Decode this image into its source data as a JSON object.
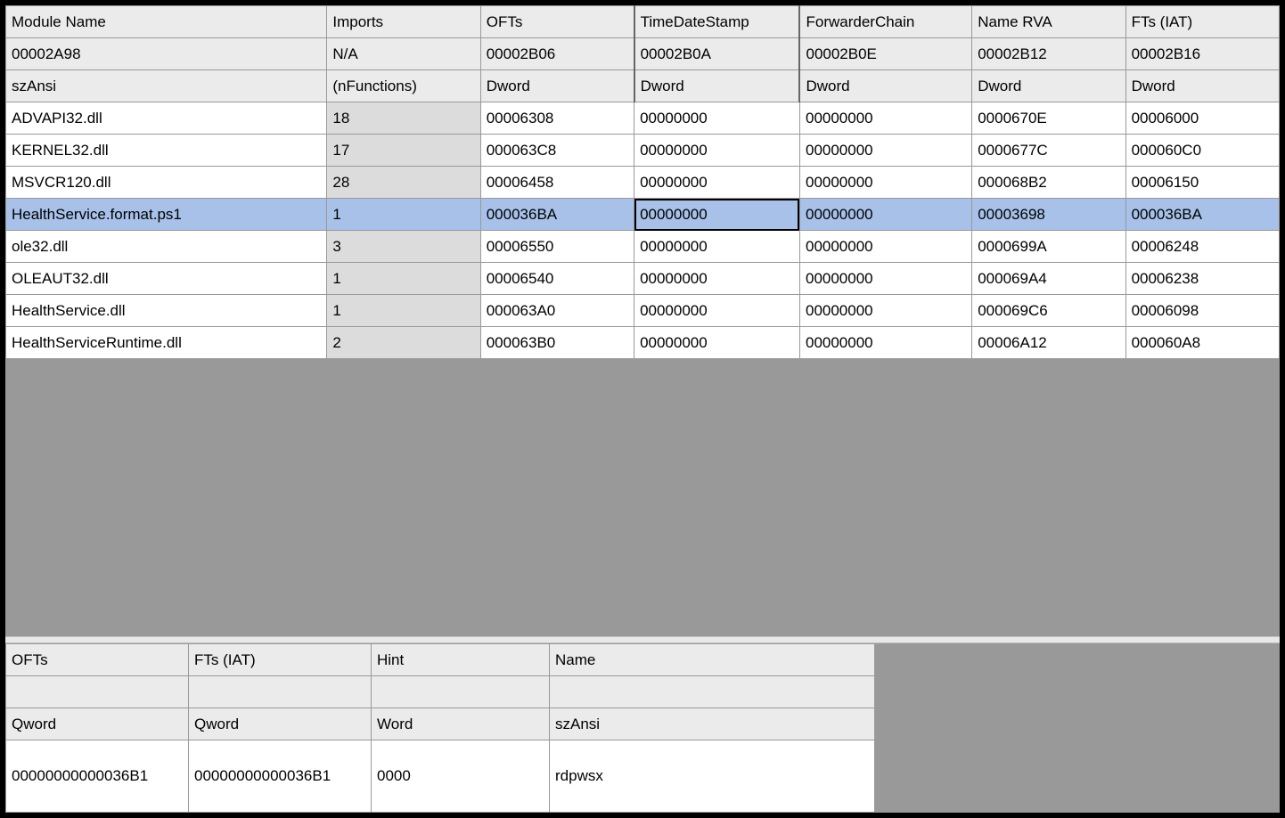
{
  "top": {
    "headers": {
      "module_name": "Module Name",
      "imports": "Imports",
      "ofts": "OFTs",
      "timedatestamp": "TimeDateStamp",
      "forwarderchain": "ForwarderChain",
      "name_rva": "Name RVA",
      "fts_iat": "FTs (IAT)"
    },
    "offsets": {
      "module_name": "00002A98",
      "imports": "N/A",
      "ofts": "00002B06",
      "timedatestamp": "00002B0A",
      "forwarderchain": "00002B0E",
      "name_rva": "00002B12",
      "fts_iat": "00002B16"
    },
    "types": {
      "module_name": "szAnsi",
      "imports": "(nFunctions)",
      "ofts": "Dword",
      "timedatestamp": "Dword",
      "forwarderchain": "Dword",
      "name_rva": "Dword",
      "fts_iat": "Dword"
    },
    "rows": [
      {
        "module_name": "ADVAPI32.dll",
        "imports": "18",
        "ofts": "00006308",
        "timedatestamp": "00000000",
        "forwarderchain": "00000000",
        "name_rva": "0000670E",
        "fts_iat": "00006000",
        "selected": false
      },
      {
        "module_name": "KERNEL32.dll",
        "imports": "17",
        "ofts": "000063C8",
        "timedatestamp": "00000000",
        "forwarderchain": "00000000",
        "name_rva": "0000677C",
        "fts_iat": "000060C0",
        "selected": false
      },
      {
        "module_name": "MSVCR120.dll",
        "imports": "28",
        "ofts": "00006458",
        "timedatestamp": "00000000",
        "forwarderchain": "00000000",
        "name_rva": "000068B2",
        "fts_iat": "00006150",
        "selected": false
      },
      {
        "module_name": "HealthService.format.ps1",
        "imports": "1",
        "ofts": "000036BA",
        "timedatestamp": "00000000",
        "forwarderchain": "00000000",
        "name_rva": "00003698",
        "fts_iat": "000036BA",
        "selected": true
      },
      {
        "module_name": "ole32.dll",
        "imports": "3",
        "ofts": "00006550",
        "timedatestamp": "00000000",
        "forwarderchain": "00000000",
        "name_rva": "0000699A",
        "fts_iat": "00006248",
        "selected": false
      },
      {
        "module_name": "OLEAUT32.dll",
        "imports": "1",
        "ofts": "00006540",
        "timedatestamp": "00000000",
        "forwarderchain": "00000000",
        "name_rva": "000069A4",
        "fts_iat": "00006238",
        "selected": false
      },
      {
        "module_name": "HealthService.dll",
        "imports": "1",
        "ofts": "000063A0",
        "timedatestamp": "00000000",
        "forwarderchain": "00000000",
        "name_rva": "000069C6",
        "fts_iat": "00006098",
        "selected": false
      },
      {
        "module_name": "HealthServiceRuntime.dll",
        "imports": "2",
        "ofts": "000063B0",
        "timedatestamp": "00000000",
        "forwarderchain": "00000000",
        "name_rva": "00006A12",
        "fts_iat": "000060A8",
        "selected": false
      }
    ]
  },
  "bottom": {
    "headers": {
      "ofts": "OFTs",
      "fts_iat": "FTs (IAT)",
      "hint": "Hint",
      "name": "Name"
    },
    "offsets": {
      "ofts": "",
      "fts_iat": "",
      "hint": "",
      "name": ""
    },
    "types": {
      "ofts": "Qword",
      "fts_iat": "Qword",
      "hint": "Word",
      "name": "szAnsi"
    },
    "rows": [
      {
        "ofts": "00000000000036B1",
        "fts_iat": "00000000000036B1",
        "hint": "0000",
        "name": "rdpwsx"
      }
    ]
  }
}
